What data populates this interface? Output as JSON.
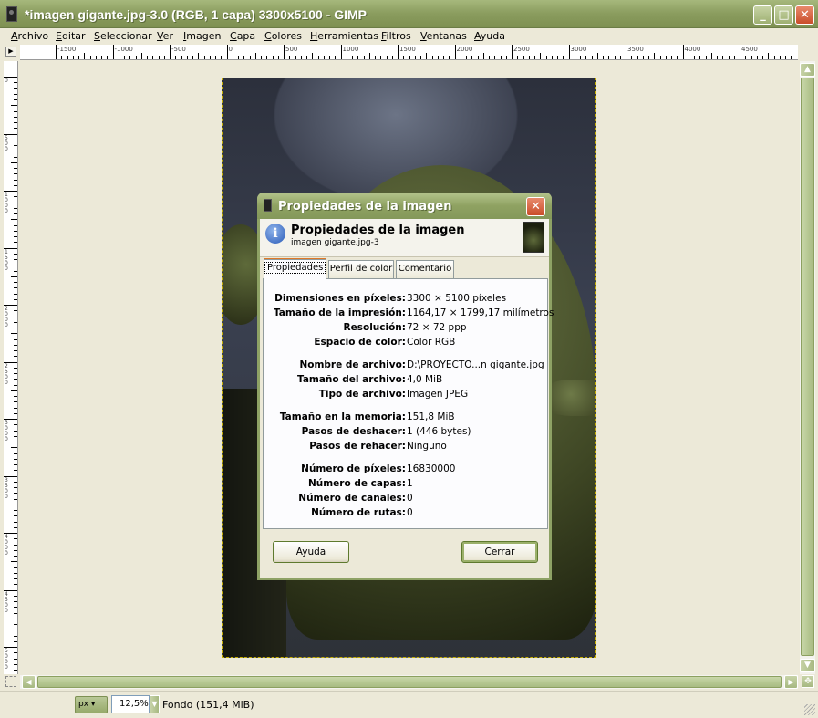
{
  "window": {
    "title": "*imagen gigante.jpg-3.0 (RGB, 1 capa) 3300x5100 - GIMP",
    "min_label": "_",
    "max_label": "□",
    "close_label": "✕"
  },
  "menu": [
    "Archivo",
    "Editar",
    "Seleccionar",
    "Ver",
    "Imagen",
    "Capa",
    "Colores",
    "Herramientas",
    "Filtros",
    "Ventanas",
    "Ayuda"
  ],
  "ruler": {
    "horizontal_labels": [
      "-1500",
      "-1000",
      "-500",
      "0",
      "500",
      "1000",
      "1500",
      "2000",
      "2500",
      "3000",
      "3500",
      "4000",
      "4500"
    ],
    "vertical_labels": [
      "0",
      "500",
      "1000",
      "1500",
      "2000",
      "2500",
      "3000",
      "3500",
      "4000",
      "4500",
      "5000"
    ]
  },
  "statusbar": {
    "unit": "px",
    "zoom": "12,5%",
    "text": "Fondo (151,4 MiB)"
  },
  "dialog": {
    "title": "Propiedades de la imagen",
    "heading": "Propiedades de la imagen",
    "subheading": "imagen gigante.jpg-3",
    "tabs": [
      "Propiedades",
      "Perfil de color",
      "Comentario"
    ],
    "properties": [
      {
        "label": "Dimensiones en píxeles:",
        "value": "3300 × 5100 píxeles"
      },
      {
        "label": "Tamaño de la impresión:",
        "value": "1164,17 × 1799,17 milímetros"
      },
      {
        "label": "Resolución:",
        "value": "72 × 72 ppp"
      },
      {
        "label": "Espacio de color:",
        "value": "Color RGB"
      },
      {
        "label": "Nombre de archivo:",
        "value": "D:\\PROYECTO...n gigante.jpg"
      },
      {
        "label": "Tamaño del archivo:",
        "value": "4,0 MiB"
      },
      {
        "label": "Tipo de archivo:",
        "value": "Imagen JPEG"
      },
      {
        "label": "Tamaño en la memoria:",
        "value": "151,8 MiB"
      },
      {
        "label": "Pasos de deshacer:",
        "value": "1 (446 bytes)"
      },
      {
        "label": "Pasos de rehacer:",
        "value": "Ninguno"
      },
      {
        "label": "Número de píxeles:",
        "value": "16830000"
      },
      {
        "label": "Número de capas:",
        "value": "1"
      },
      {
        "label": "Número de canales:",
        "value": "0"
      },
      {
        "label": "Número de rutas:",
        "value": "0"
      }
    ],
    "help_label": "Ayuda",
    "close_label": "Cerrar",
    "close_x": "✕"
  },
  "colors": {
    "titlebar": "#8a9c5e",
    "window_bg": "#ece9d8",
    "close_red": "#c94d2a",
    "tab_accent": "#e07828"
  }
}
